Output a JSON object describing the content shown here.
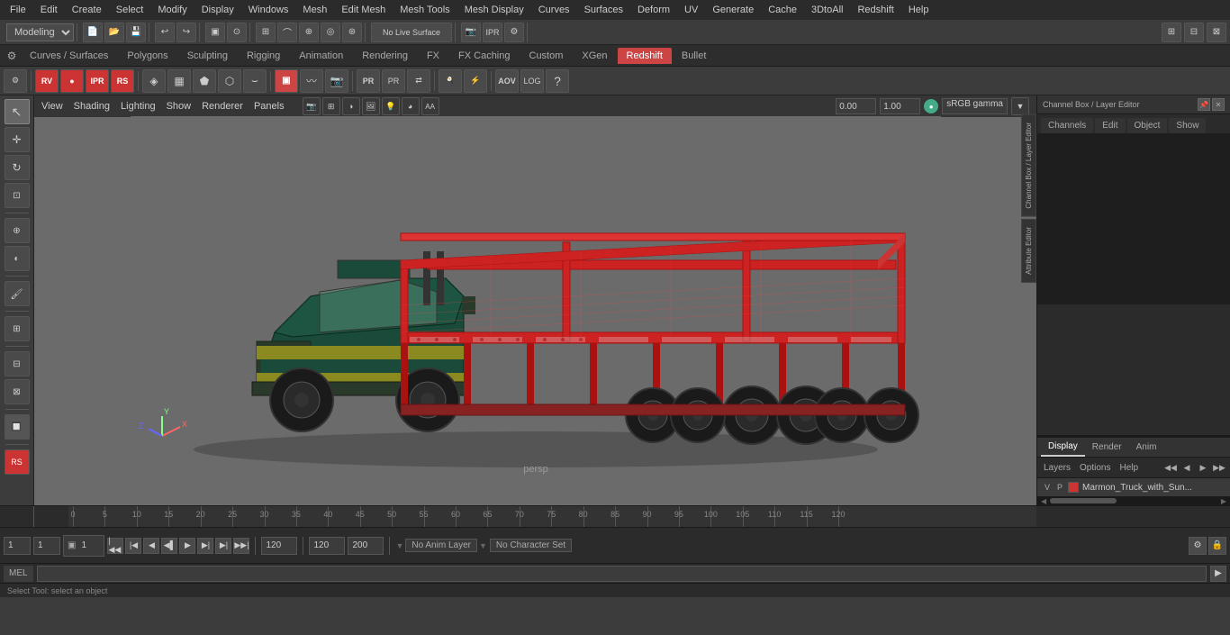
{
  "menuBar": {
    "items": [
      "File",
      "Edit",
      "Create",
      "Select",
      "Modify",
      "Display",
      "Windows",
      "Mesh",
      "Edit Mesh",
      "Mesh Tools",
      "Mesh Display",
      "Curves",
      "Surfaces",
      "Deform",
      "UV",
      "Generate",
      "Cache",
      "3DtoAll",
      "Redshift",
      "Help"
    ]
  },
  "toolbar1": {
    "mode_label": "Modeling",
    "no_live_label": "No Live Surface"
  },
  "tabs": {
    "items": [
      "Curves / Surfaces",
      "Polygons",
      "Sculpting",
      "Rigging",
      "Animation",
      "Rendering",
      "FX",
      "FX Caching",
      "Custom",
      "XGen",
      "Redshift",
      "Bullet"
    ],
    "active": "Redshift"
  },
  "viewport": {
    "menus": [
      "View",
      "Shading",
      "Lighting",
      "Show",
      "Renderer",
      "Panels"
    ],
    "label": "persp",
    "gamma": "sRGB gamma",
    "num1": "0.00",
    "num2": "1.00"
  },
  "rightPanel": {
    "title": "Channel Box / Layer Editor",
    "tabs": [
      "Channels",
      "Edit",
      "Object",
      "Show"
    ],
    "layerTabs": [
      "Display",
      "Render",
      "Anim"
    ],
    "layerMenu": [
      "Layers",
      "Options",
      "Help"
    ],
    "activeTab": "Display",
    "layer": {
      "vp": "V",
      "p": "P",
      "name": "Marmon_Truck_with_Sun..."
    }
  },
  "timeline": {
    "ticks": [
      0,
      5,
      10,
      15,
      20,
      25,
      30,
      35,
      40,
      45,
      50,
      55,
      60,
      65,
      70,
      75,
      80,
      85,
      90,
      95,
      100,
      105,
      110,
      115,
      120
    ]
  },
  "bottomBar": {
    "frame_start": "1",
    "frame_current": "1",
    "frame_display": "1",
    "frame_end_range": "120",
    "frame_end": "120",
    "range_end": "200",
    "anim_layer": "No Anim Layer",
    "char_set": "No Character Set"
  },
  "melBar": {
    "label": "MEL",
    "input_placeholder": ""
  },
  "statusBar": {
    "text": "Select Tool: select an object"
  },
  "edgeTabs": [
    "Channel Box / Layer Editor",
    "Attribute Editor"
  ]
}
